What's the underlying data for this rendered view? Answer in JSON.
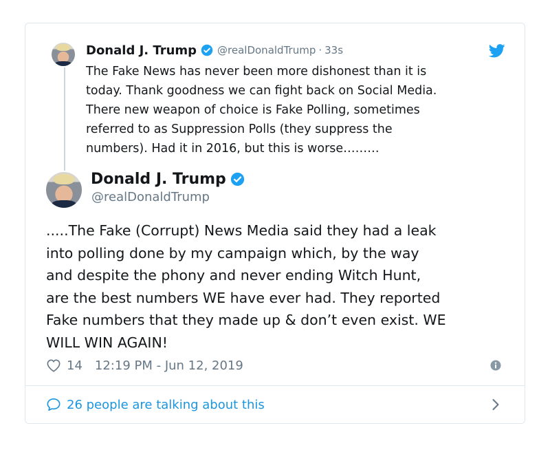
{
  "quoted_tweet": {
    "name": "Donald J. Trump",
    "handle": "@realDonaldTrump",
    "separator": "·",
    "time": "33s",
    "text": "The Fake News has never been more dishonest than it is\ntoday. Thank goodness we can fight back on Social Media.\nThere new weapon of choice is Fake Polling, sometimes\nreferred to as Suppression Polls (they suppress the\nnumbers). Had it in 2016, but this is worse………"
  },
  "main_tweet": {
    "name": "Donald J. Trump",
    "handle": "@realDonaldTrump",
    "text": ".....The Fake (Corrupt) News Media said they had a leak\ninto polling done by my campaign which, by the way\nand despite the phony and never ending Witch Hunt,\nare the best numbers WE have ever had. They reported\nFake numbers that they made up & don’t even exist. WE\nWILL WIN AGAIN!",
    "likes": "14",
    "timestamp": "12:19 PM - Jun 12, 2019"
  },
  "footer": {
    "talking_label": "26 people are talking about this"
  },
  "colors": {
    "accent": "#1da1f2",
    "link": "#1b95e0",
    "muted": "#657786",
    "border": "#e1e8ed"
  },
  "icons": {
    "brand": "twitter-bird-icon",
    "verified": "verified-badge-icon",
    "like": "heart-icon",
    "info": "info-icon",
    "reply": "speech-bubble-icon",
    "chevron": "chevron-right-icon"
  }
}
